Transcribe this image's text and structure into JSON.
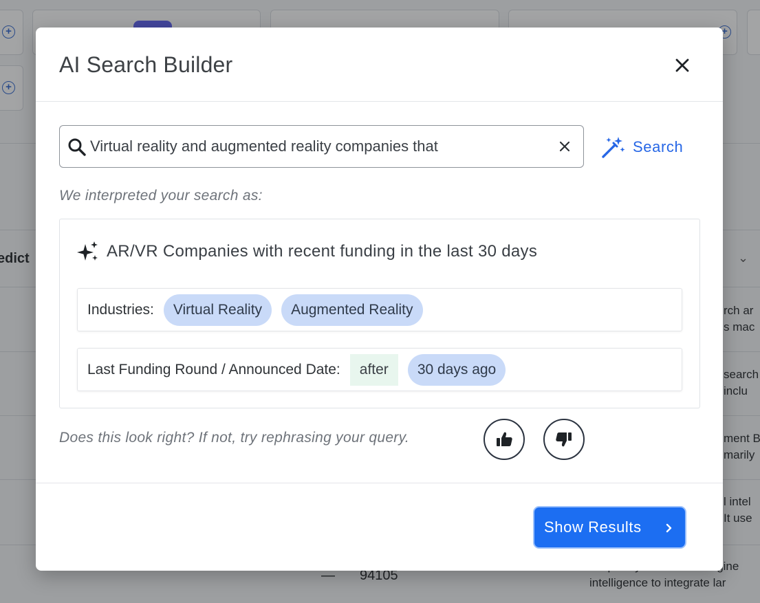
{
  "background": {
    "bottom_value": "94105",
    "bottom_dash": "—",
    "side_header": "edict",
    "right_column_fragments": [
      [
        "rch ar",
        "s mac"
      ],
      [
        "search",
        "inclu"
      ],
      [
        "ment B",
        "marily"
      ],
      [
        "l intel",
        "It use"
      ],
      [
        "Perplexity is a search engine",
        "intelligence to integrate lar"
      ]
    ]
  },
  "modal": {
    "title": "AI Search Builder",
    "search": {
      "value": "Virtual reality and augmented reality companies that",
      "button_label": "Search"
    },
    "interpreted_label": "We interpreted your search as:",
    "interpretation": {
      "title": "AR/VR Companies with recent funding in the last 30 days",
      "filters": [
        {
          "label": "Industries:",
          "operator": "",
          "values": [
            "Virtual Reality",
            "Augmented Reality"
          ]
        },
        {
          "label": "Last Funding Round / Announced Date:",
          "operator": "after",
          "values": [
            "30 days ago"
          ]
        }
      ]
    },
    "feedback_prompt": "Does this look right? If not, try rephrasing your query.",
    "show_results_label": "Show Results",
    "colors": {
      "primary": "#1c6ef2",
      "chip": "#c9daf8",
      "operator_chip": "#e8f6ee"
    }
  }
}
